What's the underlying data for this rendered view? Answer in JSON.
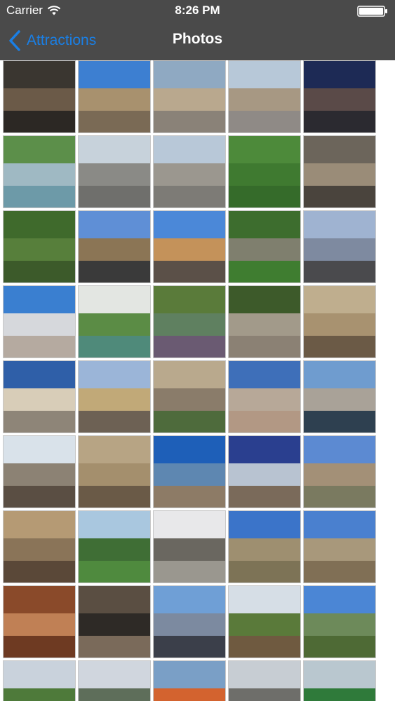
{
  "status_bar": {
    "carrier": "Carrier",
    "time": "8:26 PM",
    "wifi_icon": "wifi-icon",
    "battery_icon": "battery-icon"
  },
  "nav": {
    "back_label": "Attractions",
    "back_icon": "chevron-left-icon",
    "title": "Photos",
    "accent_color": "#1a7fe5",
    "bar_color": "#4a4a4a"
  },
  "photos": [
    {
      "top": "#3a3630",
      "mid": "#6b5a48",
      "bot": "#2c2824"
    },
    {
      "top": "#3d7fd1",
      "mid": "#a8916e",
      "bot": "#7a6a55"
    },
    {
      "top": "#8fa9c2",
      "mid": "#b9a88e",
      "bot": "#8a8278"
    },
    {
      "top": "#b7c8d8",
      "mid": "#a79883",
      "bot": "#8f8a86"
    },
    {
      "top": "#1d2a55",
      "mid": "#5a4a48",
      "bot": "#2b2a30"
    },
    {
      "top": "#5c8f4a",
      "mid": "#9fb9c3",
      "bot": "#6d9aa8"
    },
    {
      "top": "#c7d2db",
      "mid": "#8a8a86",
      "bot": "#6f6f6c"
    },
    {
      "top": "#b8c8d8",
      "mid": "#9b978f",
      "bot": "#7d7b76"
    },
    {
      "top": "#4d8a3a",
      "mid": "#3f7a30",
      "bot": "#356b2a"
    },
    {
      "top": "#6c655b",
      "mid": "#9a8c78",
      "bot": "#4a443d"
    },
    {
      "top": "#3f6a2c",
      "mid": "#577f3b",
      "bot": "#3c5a2a"
    },
    {
      "top": "#5f8fd6",
      "mid": "#8b7555",
      "bot": "#3a3a3a"
    },
    {
      "top": "#4b88d8",
      "mid": "#c4925a",
      "bot": "#5b5048"
    },
    {
      "top": "#3d6d2e",
      "mid": "#7f7f6e",
      "bot": "#3f7d30"
    },
    {
      "top": "#9fb3d1",
      "mid": "#7e8aa0",
      "bot": "#4a4a4d"
    },
    {
      "top": "#3a7fd0",
      "mid": "#d6d8dc",
      "bot": "#b5aaa0"
    },
    {
      "top": "#e3e6e2",
      "mid": "#5b8c45",
      "bot": "#4f8a7a"
    },
    {
      "top": "#5a7b3a",
      "mid": "#5f8060",
      "bot": "#6a5a72"
    },
    {
      "top": "#3d5a2a",
      "mid": "#a29a8a",
      "bot": "#8b8174"
    },
    {
      "top": "#bfae8e",
      "mid": "#a89270",
      "bot": "#6b5a46"
    },
    {
      "top": "#2f5fa8",
      "mid": "#d8cdb8",
      "bot": "#8e8578"
    },
    {
      "top": "#9bb5d8",
      "mid": "#c1a978",
      "bot": "#6d6154"
    },
    {
      "top": "#b9a98d",
      "mid": "#8a7c6a",
      "bot": "#4e6b3c"
    },
    {
      "top": "#3e6fb9",
      "mid": "#b7a898",
      "bot": "#b29884"
    },
    {
      "top": "#6f9ccf",
      "mid": "#a9a298",
      "bot": "#2e4050"
    },
    {
      "top": "#d9e2ea",
      "mid": "#8c8274",
      "bot": "#5a4e43"
    },
    {
      "top": "#b7a484",
      "mid": "#a48f6d",
      "bot": "#6a5a47"
    },
    {
      "top": "#1e5fb8",
      "mid": "#5e87b1",
      "bot": "#8d7b66"
    },
    {
      "top": "#2a3f8f",
      "mid": "#b8c3d1",
      "bot": "#7a6a5a"
    },
    {
      "top": "#5c8ad2",
      "mid": "#a39077",
      "bot": "#7a7a60"
    },
    {
      "top": "#b59a74",
      "mid": "#8a7458",
      "bot": "#5a4838"
    },
    {
      "top": "#a9c7df",
      "mid": "#3f6e35",
      "bot": "#4f8a3e"
    },
    {
      "top": "#e8e8ea",
      "mid": "#6a6760",
      "bot": "#9a978f"
    },
    {
      "top": "#3b74c9",
      "mid": "#9e8f70",
      "bot": "#7d7356"
    },
    {
      "top": "#4a80cf",
      "mid": "#a8987b",
      "bot": "#806f55"
    },
    {
      "top": "#8a4a2a",
      "mid": "#c08055",
      "bot": "#6e3a22"
    },
    {
      "top": "#5a4e42",
      "mid": "#2e2a26",
      "bot": "#7a6a5a"
    },
    {
      "top": "#6f9fd6",
      "mid": "#7c8aa0",
      "bot": "#3b3f4a"
    },
    {
      "top": "#d6dee6",
      "mid": "#5a7a3a",
      "bot": "#6f5a40"
    },
    {
      "top": "#4b86d5",
      "mid": "#6d8a5a",
      "bot": "#4e6a35"
    },
    {
      "top": "#c9d2dc",
      "mid": "#4e7a3a",
      "bot": "#3e5e2c"
    },
    {
      "top": "#d0d6de",
      "mid": "#5e6e5a",
      "bot": "#3e4a38"
    },
    {
      "top": "#7a9fc6",
      "mid": "#d3632f",
      "bot": "#4a5a3a"
    },
    {
      "top": "#c7cdd3",
      "mid": "#6e6e6a",
      "bot": "#3e5e2e"
    },
    {
      "top": "#b9c7cf",
      "mid": "#2f7a3a",
      "bot": "#2a5a30"
    }
  ]
}
